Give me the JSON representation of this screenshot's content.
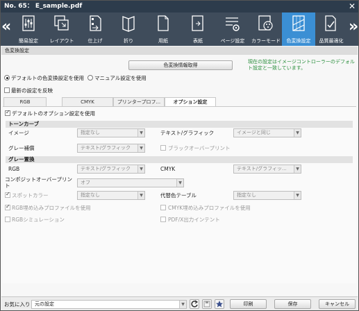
{
  "window": {
    "title": "No. 65： E_sample.pdf",
    "close": "✕"
  },
  "toolbar": {
    "prev": "«",
    "next": "»",
    "items": [
      {
        "label": "簡易設定",
        "icon": "easy-setting-icon"
      },
      {
        "label": "レイアウト",
        "icon": "layout-icon"
      },
      {
        "label": "仕上げ",
        "icon": "finishing-icon"
      },
      {
        "label": "折り",
        "icon": "folding-icon"
      },
      {
        "label": "用紙",
        "icon": "paper-icon"
      },
      {
        "label": "表紙",
        "icon": "cover-icon"
      },
      {
        "label": "ページ設定",
        "icon": "page-setting-icon"
      },
      {
        "label": "カラーモード",
        "icon": "color-mode-icon"
      },
      {
        "label": "色変換設定",
        "icon": "color-conversion-icon",
        "selected": true
      },
      {
        "label": "品質最適化",
        "icon": "quality-optimization-icon"
      }
    ]
  },
  "section_title": "色変換設定",
  "fetch_button": "色変換情報取得",
  "note": "現在の設定はイメージコントローラーのデフォルト設定と一致しています。",
  "radio_default": "デフォルトの色変換設定を使用",
  "radio_manual": "マニュアル設定を使用",
  "reflect_latest": "最新の設定を反映",
  "tabs": [
    "RGB",
    "CMYK",
    "プリンタープロフ...",
    "オプション設定"
  ],
  "option_default": "デフォルトのオプション設定を使用",
  "tone_curve": {
    "header": "トーンカーブ",
    "image_label": "イメージ",
    "image_value": "指定なし",
    "text_graphic_label": "テキスト/グラフィック",
    "text_graphic_value": "イメージと同じ"
  },
  "gray_correction": {
    "label": "グレー補償",
    "value": "テキスト/グラフィック",
    "black_overprint": "ブラックオーバープリント"
  },
  "gray_replace": {
    "header": "グレー置換",
    "rgb_label": "RGB",
    "rgb_value": "テキスト/グラフィック",
    "cmyk_label": "CMYK",
    "cmyk_value": "テキスト/グラフィッ..."
  },
  "composite": {
    "label": "コンポジットオーバープリント",
    "value": "オフ"
  },
  "spot_color": {
    "label": "スポットカラー",
    "value": "指定なし",
    "alt_table_label": "代替色テーブル",
    "alt_table_value": "指定なし"
  },
  "rgb_embed": "RGB埋め込みプロファイルを使用",
  "cmyk_embed": "CMYK埋め込みプロファイルを使用",
  "rgb_sim": "RGBシミュレーション",
  "pdfx": "PDF/X出力インテント",
  "bottom": {
    "favorites_label": "お気に入り",
    "favorites_value": "元の設定",
    "print": "印刷",
    "save": "保存",
    "cancel": "キャンセル"
  },
  "colors": {
    "accent": "#3b8fd4",
    "titlebar": "#2d3c4c",
    "toolbar": "#3f4c5b",
    "note": "#2a8f3c"
  }
}
